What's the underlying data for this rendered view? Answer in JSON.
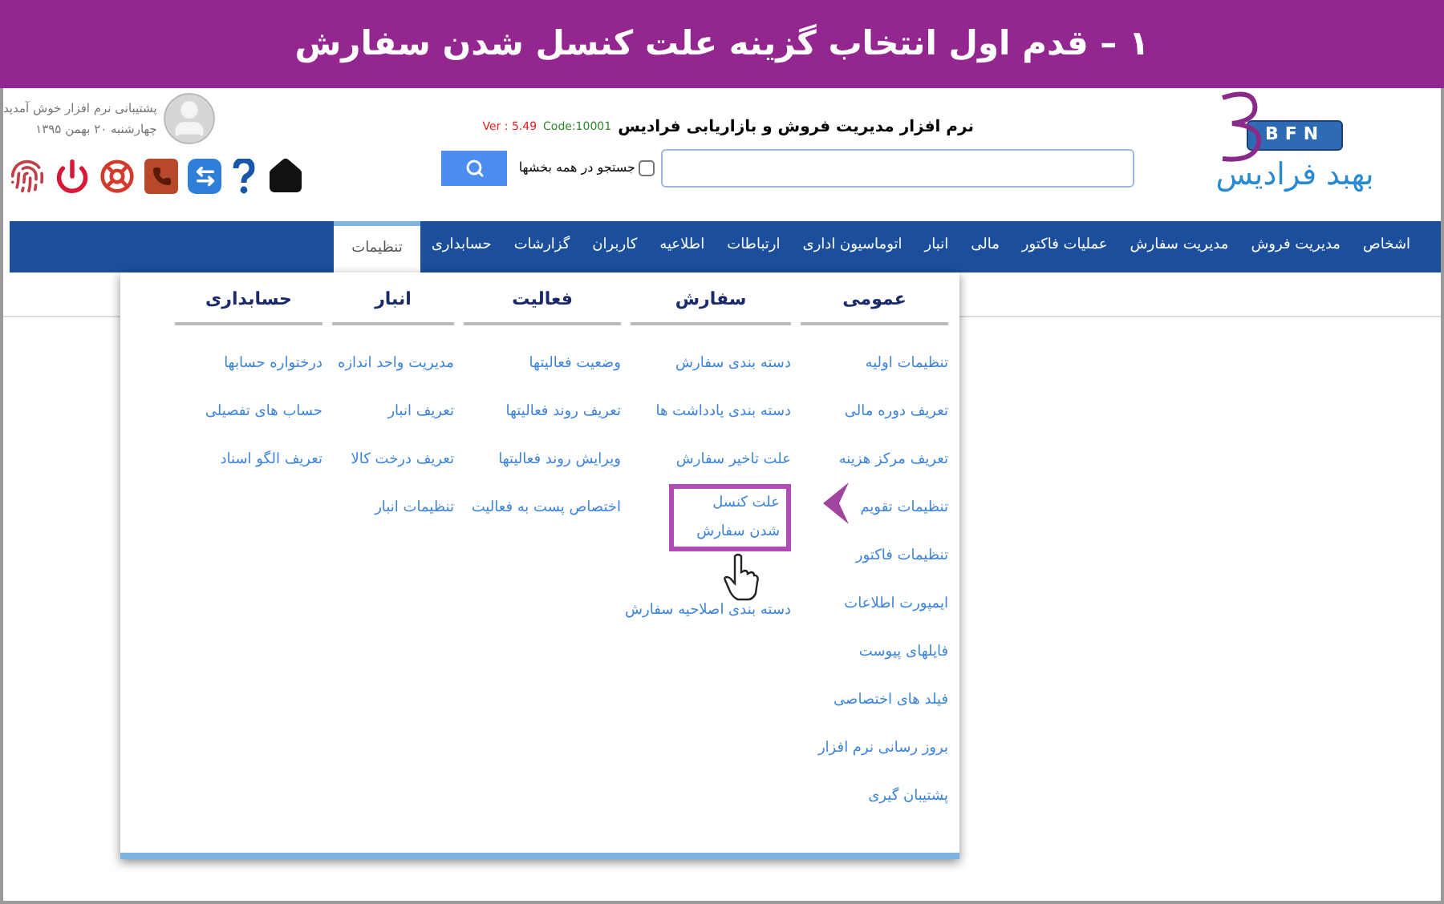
{
  "banner": {
    "title": "١ – قدم اول انتخاب گزینه علت کنسل شدن سفارش"
  },
  "logo": {
    "badge": "BFN",
    "name": "بهبد فرادیس"
  },
  "header": {
    "title": "نرم افزار مدیریت فروش و بازاریابی فرادیس",
    "code": "Code:10001",
    "version": "Ver : 5.49"
  },
  "search": {
    "all_sections": {
      "label": "جستجو در همه بخشها",
      "checked": false
    }
  },
  "user": {
    "greeting": "پشتیبانی نرم افزار خوش آمدید",
    "date": "چهارشنبه ۲۰ بهمن ۱۳۹۵"
  },
  "nav": [
    {
      "label": "اشخاص",
      "selected": false
    },
    {
      "label": "مدیریت فروش",
      "selected": false
    },
    {
      "label": "مدیریت سفارش",
      "selected": false
    },
    {
      "label": "عملیات فاکتور",
      "selected": false
    },
    {
      "label": "مالی",
      "selected": false
    },
    {
      "label": "انبار",
      "selected": false
    },
    {
      "label": "اتوماسیون اداری",
      "selected": false
    },
    {
      "label": "ارتباطات",
      "selected": false
    },
    {
      "label": "اطلاعیه",
      "selected": false
    },
    {
      "label": "کاربران",
      "selected": false
    },
    {
      "label": "گزارشات",
      "selected": false
    },
    {
      "label": "حسابداری",
      "selected": false
    },
    {
      "label": "تنظیمات",
      "selected": true
    }
  ],
  "menu": {
    "columns": [
      {
        "title": "عمومی",
        "items": [
          {
            "label": "تنظیمات اولیه",
            "highlighted": false
          },
          {
            "label": "تعریف دوره مالی",
            "highlighted": false
          },
          {
            "label": "تعریف مرکز هزینه",
            "highlighted": false
          },
          {
            "label": "تنظیمات تقویم",
            "highlighted": false
          },
          {
            "label": "تنظیمات فاکتور",
            "highlighted": false
          },
          {
            "label": "ایمپورت اطلاعات",
            "highlighted": false
          },
          {
            "label": "فایلهای پیوست",
            "highlighted": false
          },
          {
            "label": "فیلد های اختصاصی",
            "highlighted": false
          },
          {
            "label": "بروز رسانی نرم افزار",
            "highlighted": false
          },
          {
            "label": "پشتیبان گیری",
            "highlighted": false
          }
        ]
      },
      {
        "title": "سفارش",
        "items": [
          {
            "label": "دسته بندی سفارش",
            "highlighted": false
          },
          {
            "label": "دسته بندی یادداشت ها",
            "highlighted": false
          },
          {
            "label": "علت تاخیر سفارش",
            "highlighted": false
          },
          {
            "label": "علت کنسل شدن سفارش",
            "highlighted": true
          },
          {
            "label": "دسته بندی اصلاحیه سفارش",
            "highlighted": false
          }
        ]
      },
      {
        "title": "فعالیت",
        "items": [
          {
            "label": "وضعیت فعالیتها",
            "highlighted": false
          },
          {
            "label": "تعریف روند فعالیتها",
            "highlighted": false
          },
          {
            "label": "ویرایش روند فعالیتها",
            "highlighted": false
          },
          {
            "label": "اختصاص پست به فعالیت",
            "highlighted": false
          }
        ]
      },
      {
        "title": "انبار",
        "items": [
          {
            "label": "مدیریت واحد اندازه",
            "highlighted": false
          },
          {
            "label": "تعریف انبار",
            "highlighted": false
          },
          {
            "label": "تعریف درخت کالا",
            "highlighted": false
          },
          {
            "label": "تنظیمات انبار",
            "highlighted": false
          }
        ]
      },
      {
        "title": "حسابداری",
        "items": [
          {
            "label": "درختواره حسابها",
            "highlighted": false
          },
          {
            "label": "حساب های تفصیلی",
            "highlighted": false
          },
          {
            "label": "تعریف الگو اسناد",
            "highlighted": false
          }
        ]
      }
    ]
  }
}
